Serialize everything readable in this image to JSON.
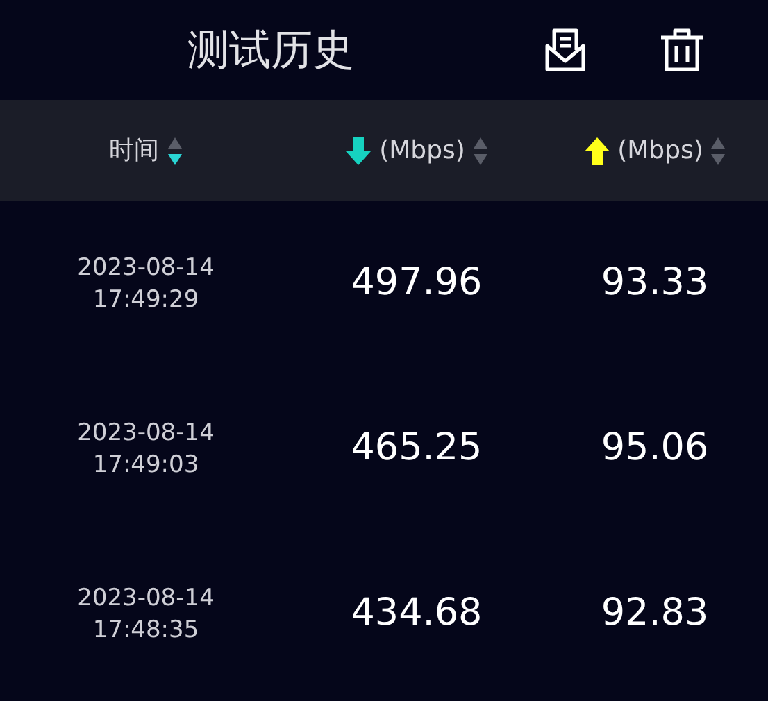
{
  "title": "测试历史",
  "columns": [
    {
      "kind": "time",
      "label": "时间",
      "sorted_descending": true
    },
    {
      "kind": "download",
      "label": "(Mbps)",
      "sorted_descending": false
    },
    {
      "kind": "upload",
      "label": "(Mbps)",
      "sorted_descending": false
    }
  ],
  "rows": [
    {
      "date": "2023-08-14",
      "time": "17:49:29",
      "download": "497.96",
      "upload": "93.33"
    },
    {
      "date": "2023-08-14",
      "time": "17:49:03",
      "download": "465.25",
      "upload": "95.06"
    },
    {
      "date": "2023-08-14",
      "time": "17:48:35",
      "download": "434.68",
      "upload": "92.83"
    }
  ]
}
